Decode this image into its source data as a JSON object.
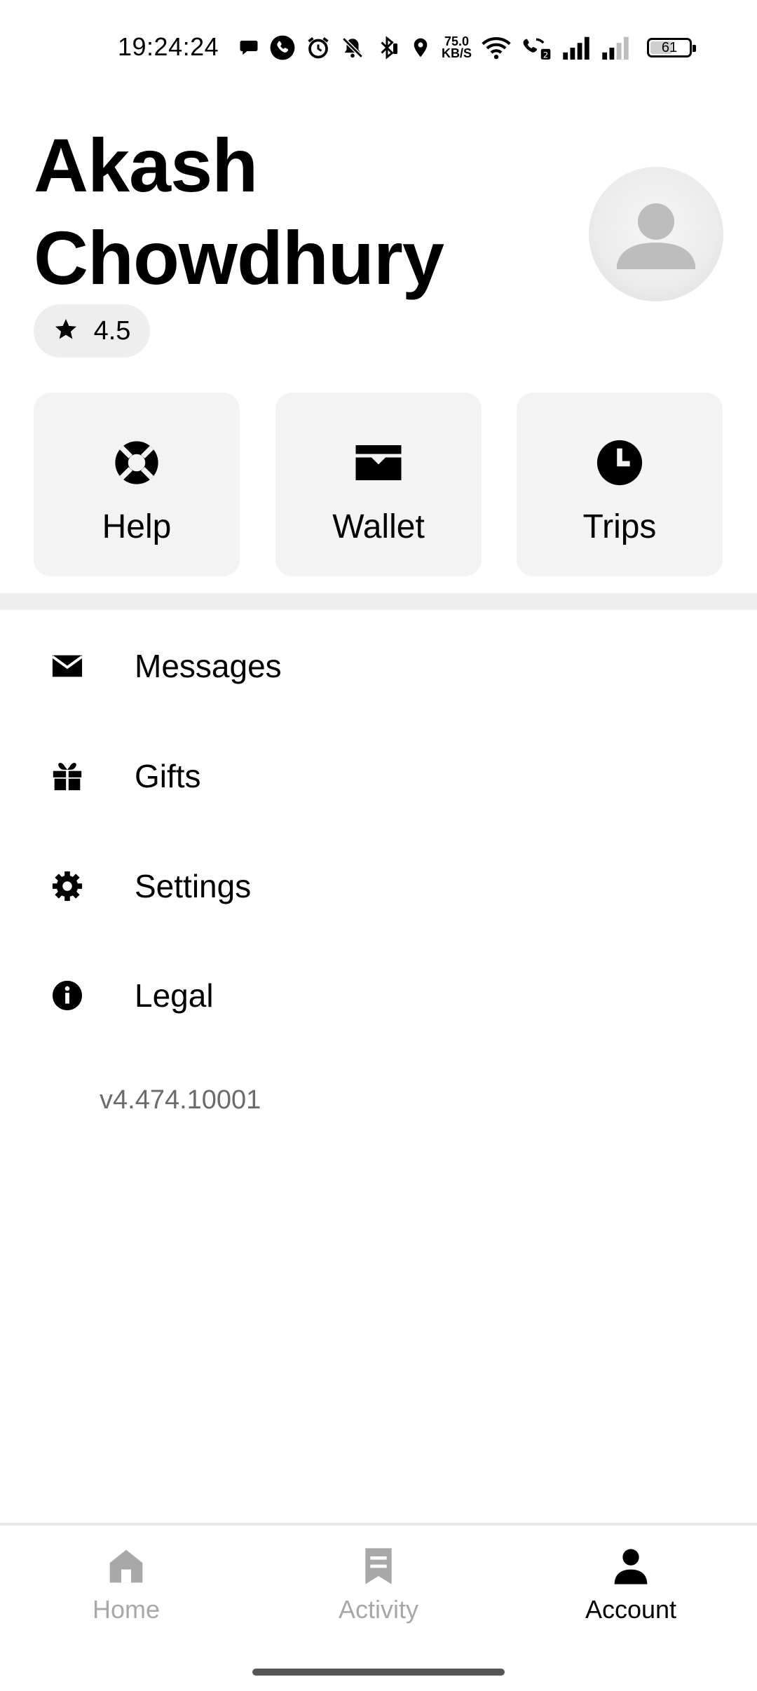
{
  "status_bar": {
    "time": "19:24:24",
    "net_speed_value": "75.0",
    "net_speed_unit": "KB/S",
    "battery_level": "61",
    "icons": [
      "chat-bubble-icon",
      "phone-icon",
      "alarm-icon",
      "bell-muted-icon",
      "bluetooth-icon",
      "location-icon",
      "wifi-icon",
      "wifi-calling-icon",
      "signal-icon",
      "signal-icon",
      "battery-icon"
    ]
  },
  "profile": {
    "name_line1": "Akash",
    "name_line2": "Chowdhury",
    "rating": "4.5",
    "rating_icon": "star-icon",
    "avatar_icon": "person-placeholder-icon"
  },
  "tiles": [
    {
      "label": "Help",
      "icon": "lifebuoy-icon"
    },
    {
      "label": "Wallet",
      "icon": "wallet-icon"
    },
    {
      "label": "Trips",
      "icon": "clock-icon"
    }
  ],
  "menu": [
    {
      "label": "Messages",
      "icon": "envelope-icon"
    },
    {
      "label": "Gifts",
      "icon": "gift-icon"
    },
    {
      "label": "Settings",
      "icon": "gear-icon"
    },
    {
      "label": "Legal",
      "icon": "info-icon"
    }
  ],
  "version": "v4.474.10001",
  "bottom_nav": {
    "items": [
      {
        "label": "Home",
        "icon": "home-icon",
        "active": false
      },
      {
        "label": "Activity",
        "icon": "receipt-icon",
        "active": false
      },
      {
        "label": "Account",
        "icon": "person-icon",
        "active": true
      }
    ]
  },
  "colors": {
    "tile_background": "#f3f3f3",
    "inactive_nav": "#a8a8a8",
    "active_nav": "#000000",
    "version_text": "#6b6b6b"
  }
}
